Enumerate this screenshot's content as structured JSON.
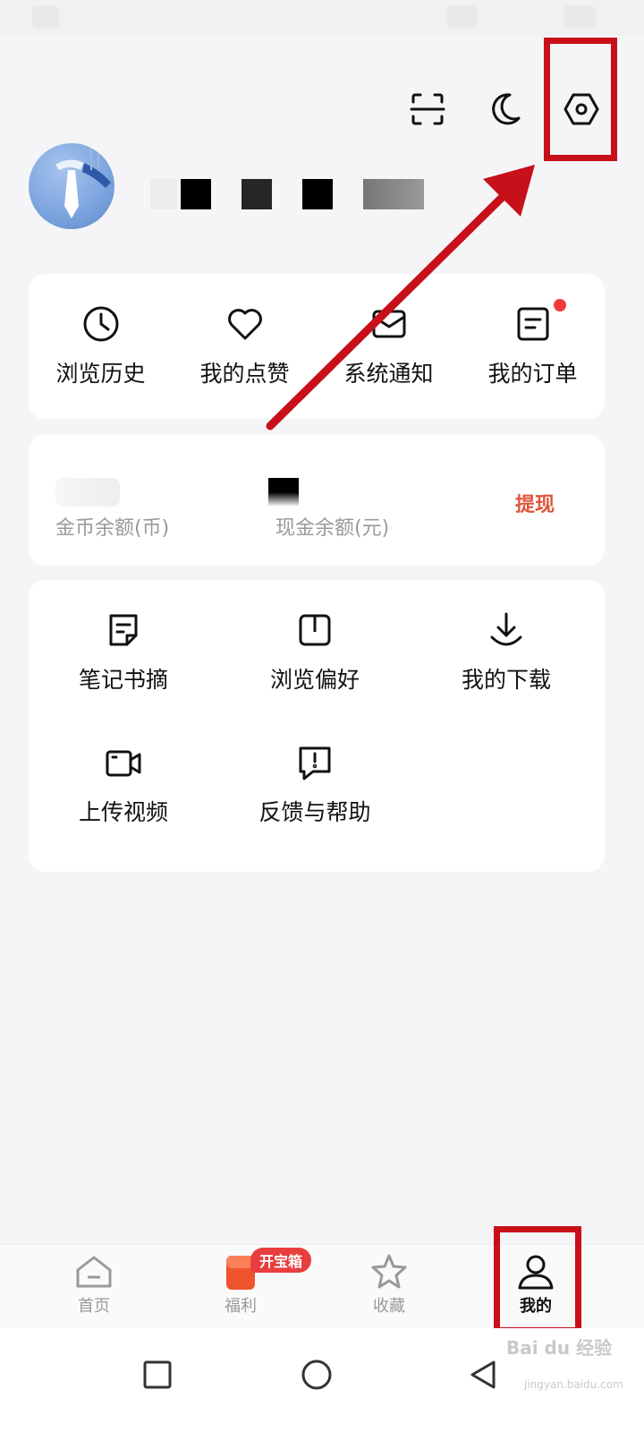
{
  "header": {
    "icons": [
      "scan-icon",
      "night-mode-icon",
      "settings-icon"
    ]
  },
  "quick_actions": [
    {
      "label": "浏览历史",
      "icon": "clock-icon"
    },
    {
      "label": "我的点赞",
      "icon": "heart-icon"
    },
    {
      "label": "系统通知",
      "icon": "mail-icon"
    },
    {
      "label": "我的订单",
      "icon": "order-icon",
      "has_dot": true
    }
  ],
  "balance": {
    "coin_label": "金币余额(币)",
    "cash_label": "现金余额(元)",
    "withdraw_label": "提现"
  },
  "tools": [
    {
      "label": "笔记书摘",
      "icon": "note-icon"
    },
    {
      "label": "浏览偏好",
      "icon": "book-icon"
    },
    {
      "label": "我的下载",
      "icon": "download-icon"
    },
    {
      "label": "上传视频",
      "icon": "video-camera-icon"
    },
    {
      "label": "反馈与帮助",
      "icon": "feedback-icon"
    }
  ],
  "bottom_nav": {
    "items": [
      {
        "label": "首页",
        "icon": "home-icon"
      },
      {
        "label": "福利",
        "icon": "gift-icon"
      },
      {
        "label": "收藏",
        "icon": "star-icon"
      },
      {
        "label": "我的",
        "icon": "profile-icon",
        "active": true
      }
    ],
    "promo_badge": "开宝箱"
  },
  "watermark": {
    "brand": "Bai du 经验",
    "url": "jingyan.baidu.com"
  },
  "colors": {
    "accent_red": "#c8101a",
    "withdraw_orange": "#e0543a",
    "badge_red": "#e83e3e",
    "background": "#f5f5f7"
  }
}
